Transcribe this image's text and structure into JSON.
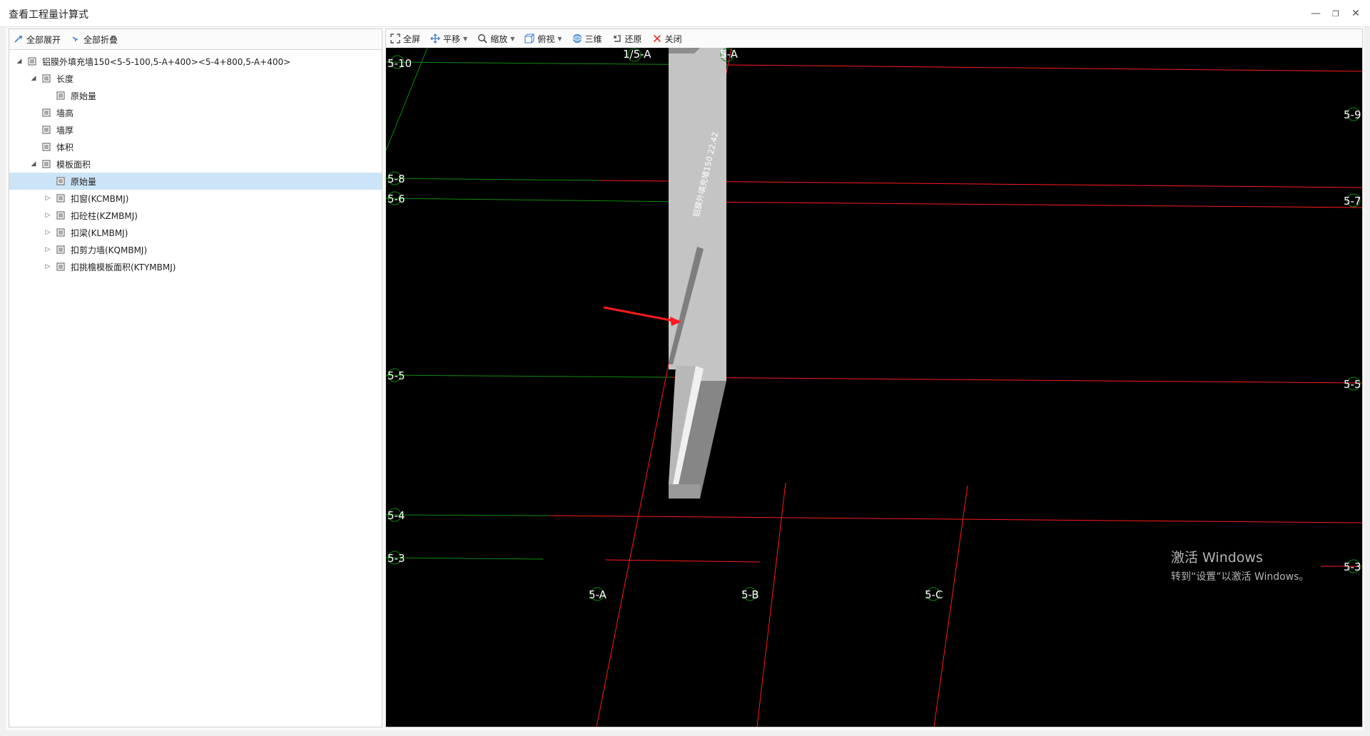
{
  "window": {
    "title": "查看工程量计算式",
    "controls": [
      "—",
      "❐",
      "✕"
    ]
  },
  "left_toolbar": {
    "expand_all": "全部展开",
    "collapse_all": "全部折叠"
  },
  "tree": [
    {
      "label": "铝膜外填充墙150<5-5-100,5-A+400><5-4+800,5-A+400>",
      "level": 0,
      "toggle": "expanded",
      "selected": false
    },
    {
      "label": "长度",
      "level": 1,
      "toggle": "expanded",
      "selected": false
    },
    {
      "label": "原始量",
      "level": 2,
      "toggle": "none",
      "selected": false
    },
    {
      "label": "墙高",
      "level": 1,
      "toggle": "none",
      "selected": false
    },
    {
      "label": "墙厚",
      "level": 1,
      "toggle": "none",
      "selected": false
    },
    {
      "label": "体积",
      "level": 1,
      "toggle": "none",
      "selected": false
    },
    {
      "label": "模板面积",
      "level": 1,
      "toggle": "expanded",
      "selected": false
    },
    {
      "label": "原始量",
      "level": 2,
      "toggle": "none",
      "selected": true
    },
    {
      "label": "扣窗(KCMBMJ)",
      "level": 2,
      "toggle": "collapsed",
      "selected": false
    },
    {
      "label": "扣砼柱(KZMBMJ)",
      "level": 2,
      "toggle": "collapsed",
      "selected": false
    },
    {
      "label": "扣梁(KLMBMJ)",
      "level": 2,
      "toggle": "collapsed",
      "selected": false
    },
    {
      "label": "扣剪力墙(KQMBMJ)",
      "level": 2,
      "toggle": "collapsed",
      "selected": false
    },
    {
      "label": "扣挑檐模板面积(KTYMBMJ)",
      "level": 2,
      "toggle": "collapsed",
      "selected": false
    }
  ],
  "view_toolbar": {
    "fullscreen": "全屏",
    "pan": "平移",
    "zoom": "缩放",
    "top_view": "俯视",
    "three_d": "三维",
    "restore": "还原",
    "close": "关闭"
  },
  "canvas": {
    "grid_labels_left": [
      "5-10",
      "5-8",
      "5-6",
      "5-5",
      "5-4",
      "5-3"
    ],
    "grid_labels_right": [
      "5-9",
      "5-7",
      "5-5",
      "5-3"
    ],
    "grid_labels_bottom": [
      "5-A",
      "5-B",
      "5-C"
    ],
    "grid_labels_top": [
      "1/5-A",
      "5-A"
    ],
    "wall_label": "铝膜外填充墙150 22.42",
    "colors": {
      "background": "#000000",
      "green_axis": "#0f8a0f",
      "red_axis": "#ff1a1a",
      "wall_light": "#c4c4c4",
      "wall_dark": "#868686"
    }
  },
  "watermark": {
    "line1": "激活 Windows",
    "line2": "转到“设置”以激活 Windows。"
  }
}
